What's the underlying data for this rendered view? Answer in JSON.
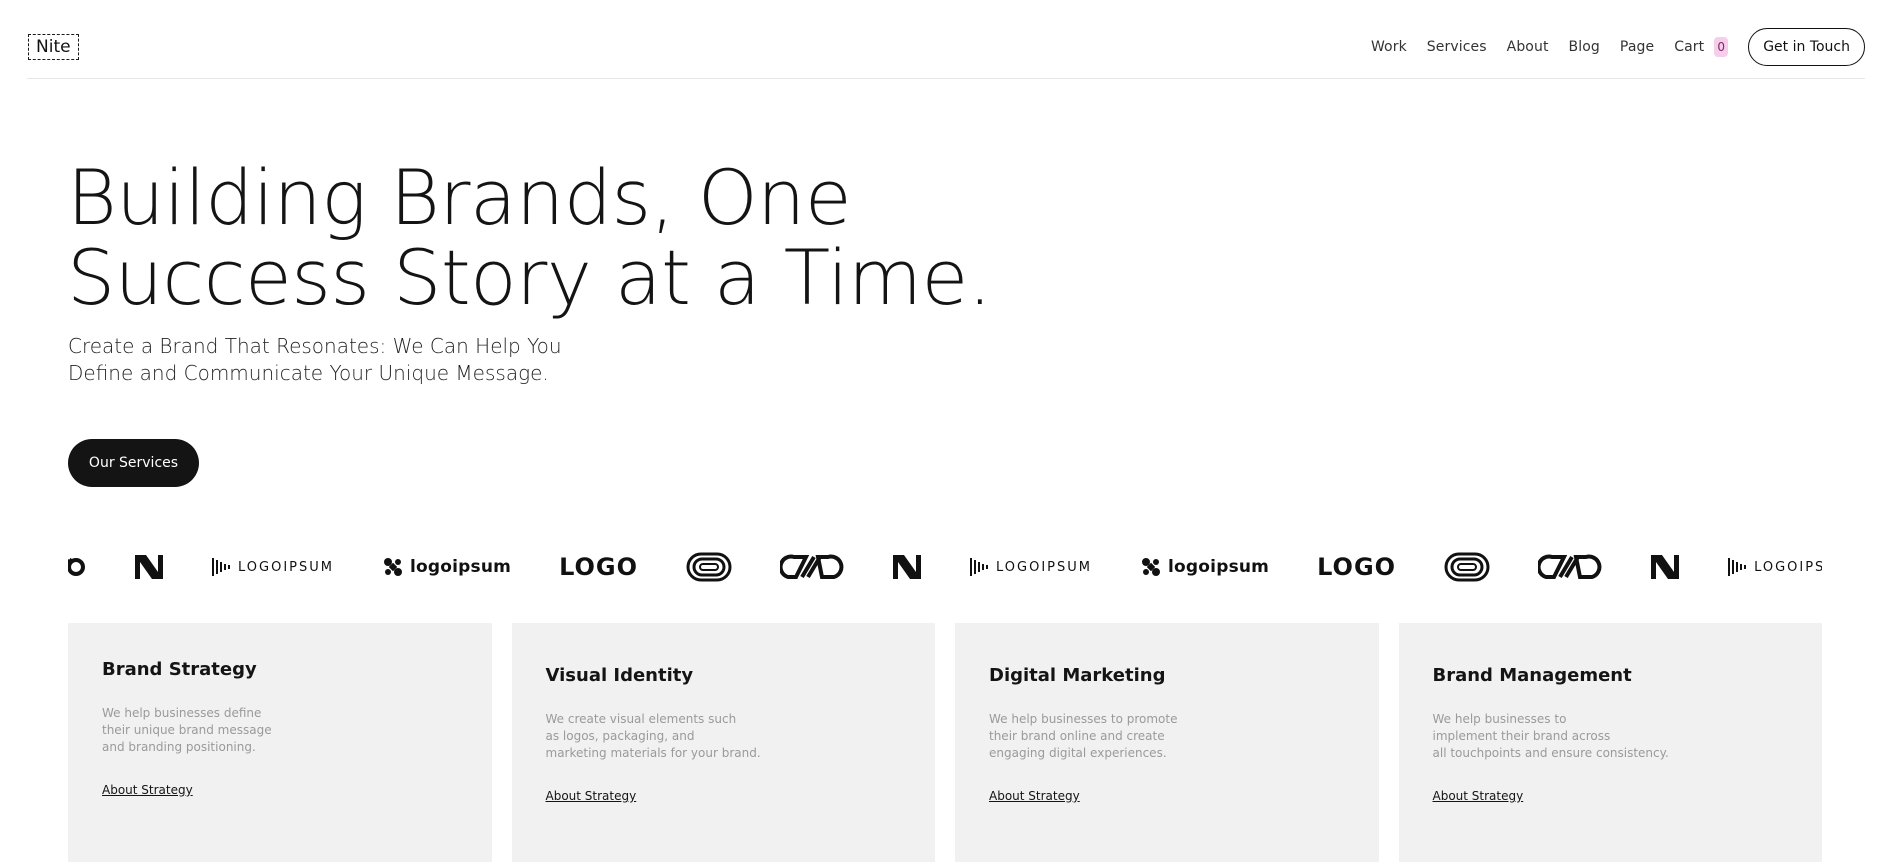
{
  "header": {
    "logo": "Nite",
    "nav": [
      {
        "label": "Work"
      },
      {
        "label": "Services"
      },
      {
        "label": "About"
      },
      {
        "label": "Blog"
      },
      {
        "label": "Page"
      },
      {
        "label": "Cart"
      }
    ],
    "cart_count": "0",
    "cta_label": "Get in Touch"
  },
  "hero": {
    "title_line1": "Building Brands, One",
    "title_line2": "Success Story at a Time.",
    "subtitle_line1": "Create a Brand That Resonates: We Can Help You",
    "subtitle_line2": "Define and Communicate Your Unique Message.",
    "button_label": "Our Services"
  },
  "logo_strip": {
    "logoipsum_spaced": "LOGOIPSUM",
    "logoipsum_bold": "logoipsum",
    "logo_word": "LOGO"
  },
  "services": [
    {
      "title": "Brand Strategy",
      "desc": [
        "We help businesses define",
        "their unique brand message",
        "and branding positioning."
      ],
      "link": "About Strategy"
    },
    {
      "title": "Visual Identity",
      "desc": [
        "We create visual elements such",
        "as logos, packaging, and",
        "marketing materials for your brand."
      ],
      "link": "About Strategy"
    },
    {
      "title": "Digital Marketing",
      "desc": [
        "We help businesses to promote",
        "their brand online and create",
        "engaging digital experiences."
      ],
      "link": "About Strategy"
    },
    {
      "title": "Brand Management",
      "desc": [
        "We help businesses to",
        "implement their brand across",
        "all touchpoints and ensure consistency."
      ],
      "link": "About Strategy"
    }
  ]
}
